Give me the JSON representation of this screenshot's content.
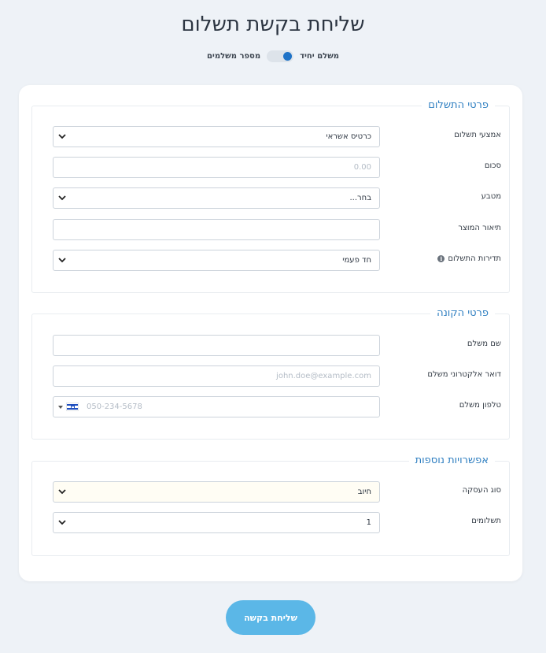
{
  "title": "שליחת בקשת תשלום",
  "toggle": {
    "left_label": "מספר משלמים",
    "right_label": "משלם יחיד"
  },
  "sections": {
    "payment": {
      "legend": "פרטי התשלום",
      "method_label": "אמצעי תשלום",
      "method_value": "כרטיס אשראי",
      "amount_label": "סכום",
      "amount_placeholder": "0.00",
      "currency_label": "מטבע",
      "currency_value": "בחר...",
      "description_label": "תיאור המוצר",
      "description_value": "",
      "frequency_label": "תדירות התשלום",
      "frequency_value": "חד פעמי"
    },
    "buyer": {
      "legend": "פרטי הקונה",
      "name_label": "שם משלם",
      "name_value": "",
      "email_label": "דואר אלקטרוני משלם",
      "email_placeholder": "john.doe@example.com",
      "phone_label": "טלפון משלם",
      "phone_placeholder": "050-234-5678"
    },
    "extra": {
      "legend": "אפשרויות נוספות",
      "transaction_label": "סוג העסקה",
      "transaction_value": "חיוב",
      "installments_label": "תשלומים",
      "installments_value": "1"
    }
  },
  "submit_label": "שליחת בקשה",
  "colors": {
    "accent": "#2f7fc1",
    "toggle_knob": "#1e72c7",
    "submit_bg": "#5bb7e7",
    "page_bg": "#eef2f7"
  },
  "icons": {
    "chevron": "chevron-down-icon",
    "info": "info-icon",
    "flag": "israel-flag-icon"
  }
}
